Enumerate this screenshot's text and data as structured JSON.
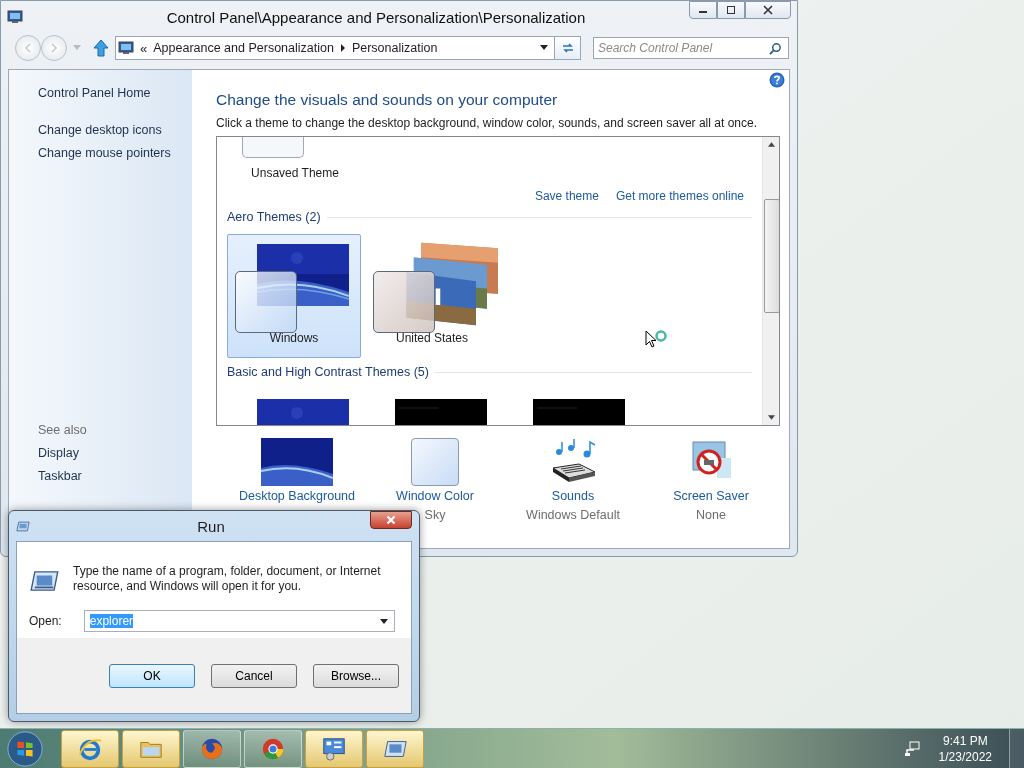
{
  "control_panel": {
    "title": "Control Panel\\Appearance and Personalization\\Personalization",
    "address": {
      "overflow": "«",
      "crumbs": [
        "Appearance and Personalization",
        "Personalization"
      ]
    },
    "search": {
      "placeholder": "Search Control Panel"
    },
    "sidebar": {
      "links": [
        "Control Panel Home",
        "Change desktop icons",
        "Change mouse pointers"
      ],
      "see_also_heading": "See also",
      "see_also": [
        "Display",
        "Taskbar"
      ]
    },
    "heading": "Change the visuals and sounds on your computer",
    "description": "Click a theme to change the desktop background, window color, sounds, and screen saver all at once.",
    "themes": {
      "top_item": "Unsaved Theme",
      "actions": [
        "Save theme",
        "Get more themes online"
      ],
      "groups": [
        {
          "title": "Aero Themes (2)",
          "items": [
            {
              "name": "Windows",
              "kind": "windows",
              "selected": true
            },
            {
              "name": "United States",
              "kind": "photos",
              "selected": false
            }
          ]
        },
        {
          "title": "Basic and High Contrast Themes (5)",
          "items": [
            {
              "kind": "windows",
              "selected": false
            },
            {
              "kind": "dark",
              "selected": false
            },
            {
              "kind": "dark",
              "selected": false
            }
          ]
        }
      ]
    },
    "settings": [
      {
        "kind": "background",
        "label": "Desktop Background"
      },
      {
        "kind": "color",
        "label": "Window Color",
        "value": "Sky"
      },
      {
        "kind": "sounds",
        "label": "Sounds",
        "value": "Windows Default"
      },
      {
        "kind": "screensaver",
        "label": "Screen Saver",
        "value": "None"
      }
    ]
  },
  "run_dialog": {
    "title": "Run",
    "message": "Type the name of a program, folder, document, or Internet resource, and Windows will open it for you.",
    "open_label": "Open:",
    "value": "explorer",
    "buttons": [
      {
        "label": "OK",
        "default": true
      },
      {
        "label": "Cancel",
        "default": false
      },
      {
        "label": "Browse...",
        "default": false
      }
    ]
  },
  "taskbar": {
    "apps": [
      {
        "kind": "ie",
        "highlighted": true
      },
      {
        "kind": "folder",
        "highlighted": true
      },
      {
        "kind": "firefox",
        "highlighted": false
      },
      {
        "kind": "chrome",
        "highlighted": false
      },
      {
        "kind": "control-panel",
        "highlighted": true
      },
      {
        "kind": "run",
        "highlighted": true
      }
    ],
    "time": "9:41 PM",
    "date": "1/23/2022"
  }
}
